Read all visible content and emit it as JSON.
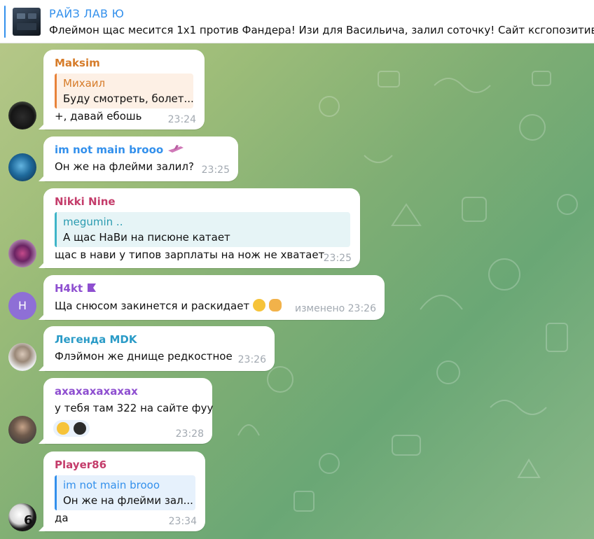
{
  "pinned": {
    "title": "РАЙЗ ЛАВ Ю",
    "text": "Флеймон щас месится 1х1 против Фандера! Изи для Васильича, залил соточку!  Сайт ксгопозитив"
  },
  "messages": [
    {
      "author": "Maksim",
      "author_color": "#d67c2a",
      "reply_author": "Михаил",
      "reply_text": "Буду смотреть, болет...",
      "text": "+, давай ебошь",
      "time": "23:24"
    },
    {
      "author": "im not main brooo",
      "author_color": "#3390ec",
      "text": "Он же на флейми залил?",
      "time": "23:25"
    },
    {
      "author": "Nikki Nine",
      "author_color": "#c43d6b",
      "reply_author": "megumin ..",
      "reply_text": "А щас НаВи на писюне катает",
      "text": "щас в нави у типов зарплаты на нож не хватает",
      "time": "23:25"
    },
    {
      "author": "H4kt",
      "author_color": "#8e4fd0",
      "avatar_letter": "H",
      "text": "Ща снюсом закинется и раскидает",
      "time": "изменено 23:26"
    },
    {
      "author": "Легенда MDK",
      "author_color": "#2a9bc7",
      "text": "Флэймон же днище редкостное",
      "time": "23:26"
    },
    {
      "author": "ахахахахахах",
      "author_color": "#8e4fd0",
      "text": "у тебя там 322 на сайте фуу",
      "time": "23:28"
    },
    {
      "author": "Player86",
      "author_color": "#c43d6b",
      "reply_author": "im not main brooo",
      "reply_text": "Он же на флейми зал...",
      "text": "да",
      "time": "23:34"
    }
  ],
  "colors": {
    "accent": "#3390ec",
    "reply_orange_bg": "#fdf0e5",
    "reply_orange_bar": "#e8833a",
    "reply_teal_bg": "#e6f4f6",
    "reply_teal_bar": "#3fb5c8",
    "reply_blue_bg": "#e6f1fc",
    "reply_blue_bar": "#3390ec"
  }
}
